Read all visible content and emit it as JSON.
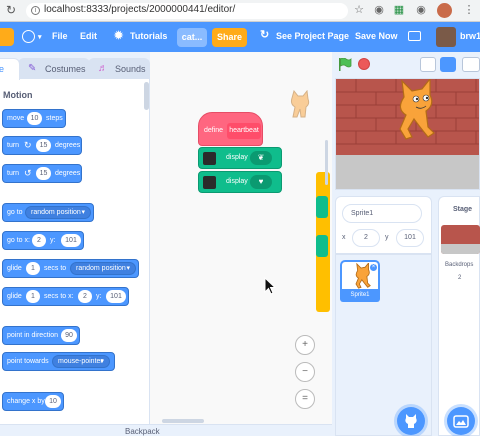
{
  "browser": {
    "url": "localhost:8333/projects/2000000441/editor/",
    "info_icon": "i"
  },
  "menubar": {
    "file": "File",
    "edit": "Edit",
    "tutorials": "Tutorials",
    "project_title": "cat...",
    "share": "Share",
    "see_project_page": "See Project Page",
    "save_now": "Save Now",
    "username": "brw1"
  },
  "tabs": {
    "code": "e",
    "costumes": "Costumes",
    "sounds": "Sounds"
  },
  "palette": {
    "category_title": "Motion",
    "blocks": {
      "move": {
        "pre": "move",
        "value": "10",
        "post": "steps"
      },
      "turn_right": {
        "pre": "turn",
        "value": "15",
        "post": "degrees"
      },
      "turn_left": {
        "pre": "turn",
        "value": "15",
        "post": "degrees"
      },
      "go_to": {
        "pre": "go to",
        "option": "random position"
      },
      "go_to_xy": {
        "pre": "go to x:",
        "x": "2",
        "mid": "y:",
        "y": "101"
      },
      "glide_to": {
        "pre": "glide",
        "secs": "1",
        "mid": "secs to",
        "option": "random position"
      },
      "glide_xy": {
        "pre": "glide",
        "secs": "1",
        "mid": "secs to x:",
        "x": "2",
        "mid2": "y:",
        "y": "101"
      },
      "point_dir": {
        "pre": "point in direction",
        "value": "90"
      },
      "point_towards": {
        "pre": "point towards",
        "option": "mouse-pointer"
      },
      "change_x": {
        "pre": "change x by",
        "value": "10"
      }
    }
  },
  "code": {
    "define_label": "define",
    "define_name": "heartbeat",
    "display_label_1": "display",
    "display_label_2": "display",
    "led_1": "❦",
    "led_2": "♥",
    "zoom_in": "+",
    "zoom_out": "−",
    "zoom_reset": "="
  },
  "backpack": {
    "label": "Backpack"
  },
  "sprite_info": {
    "name": "Sprite1",
    "x_label": "x",
    "x_value": "2",
    "y_label": "y",
    "y_value": "101"
  },
  "sprite_list": {
    "sprite_label": "Sprite1",
    "delete": "×"
  },
  "stage_pane": {
    "title": "Stage",
    "backdrops_label": "Backdrops",
    "backdrops_count": "2"
  },
  "colors": {
    "motion": "#4c97ff",
    "my_blocks": "#ff6680",
    "microbit": "#0fbd8c",
    "accent": "#4c97ff",
    "share": "#ffab19"
  }
}
